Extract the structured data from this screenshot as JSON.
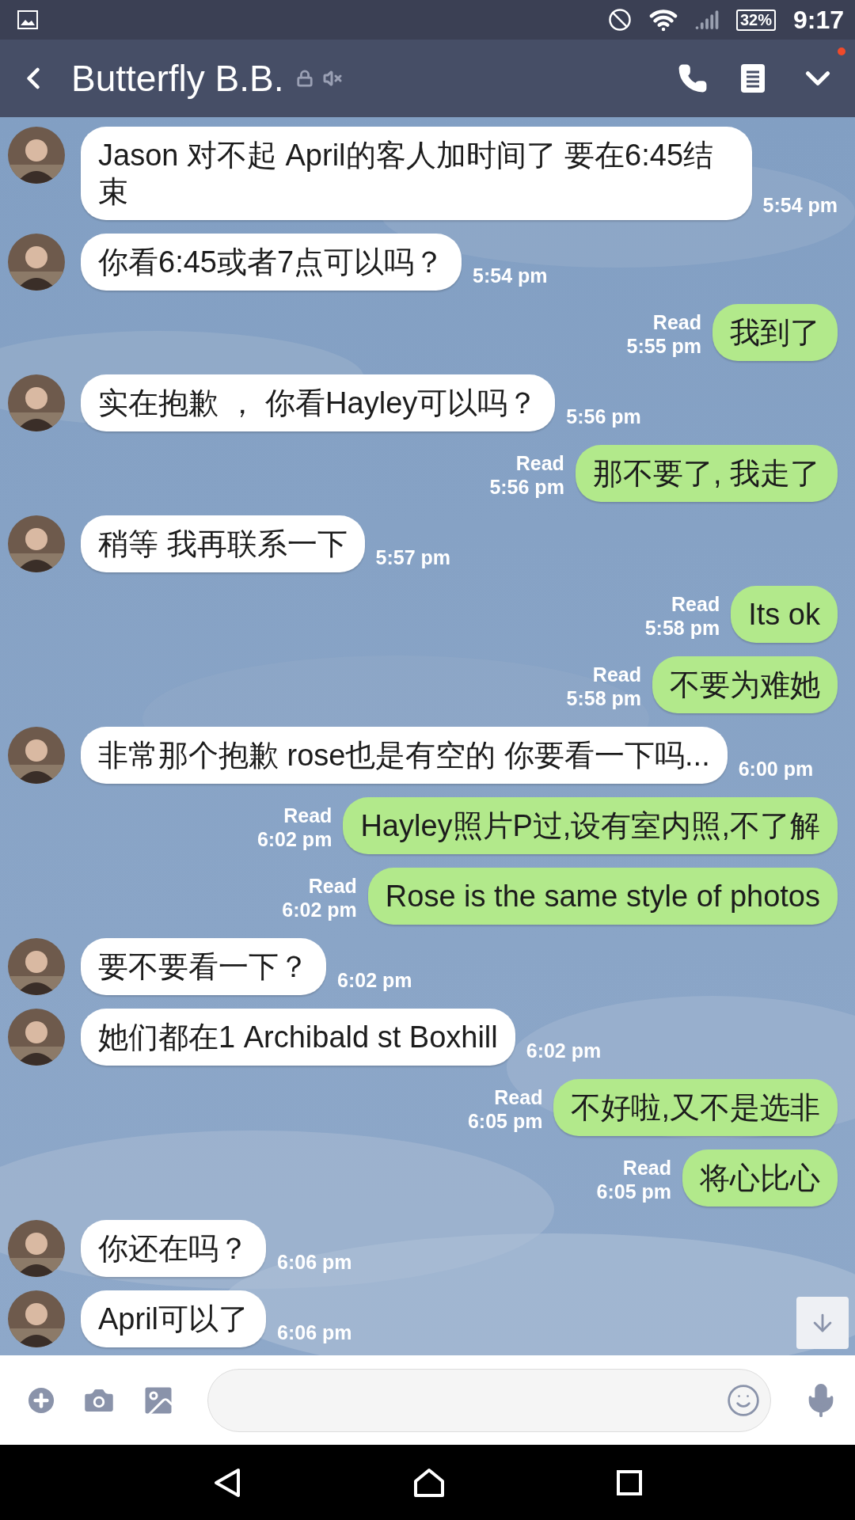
{
  "status_bar": {
    "battery": "32%",
    "time": "9:17"
  },
  "header": {
    "title": "Butterfly B.B.",
    "locked": true,
    "muted": true,
    "menu_badge": true
  },
  "messages": [
    {
      "kind": "in",
      "text": "Jason 对不起 April的客人加时间了 要在6:45结束",
      "time": "5:54 pm"
    },
    {
      "kind": "in",
      "text": "你看6:45或者7点可以吗？",
      "time": "5:54 pm"
    },
    {
      "kind": "out",
      "text": "我到了",
      "read": "Read",
      "time": "5:55 pm"
    },
    {
      "kind": "in",
      "text": "实在抱歉 ， 你看Hayley可以吗？",
      "time": "5:56 pm"
    },
    {
      "kind": "out",
      "text": "那不要了, 我走了",
      "read": "Read",
      "time": "5:56 pm"
    },
    {
      "kind": "in",
      "text": "稍等 我再联系一下",
      "time": "5:57 pm"
    },
    {
      "kind": "out",
      "text": "Its ok",
      "read": "Read",
      "time": "5:58 pm"
    },
    {
      "kind": "out",
      "text": "不要为难她",
      "read": "Read",
      "time": "5:58 pm"
    },
    {
      "kind": "in",
      "text": "非常那个抱歉 rose也是有空的 你要看一下吗...",
      "time": "6:00 pm"
    },
    {
      "kind": "out",
      "text": "Hayley照片P过,设有室内照,不了解",
      "read": "Read",
      "time": "6:02 pm"
    },
    {
      "kind": "out",
      "text": "Rose is the same style of photos",
      "read": "Read",
      "time": "6:02 pm"
    },
    {
      "kind": "in",
      "text": "要不要看一下？",
      "time": "6:02 pm"
    },
    {
      "kind": "in",
      "text": "她们都在1 Archibald st Boxhill",
      "time": "6:02 pm"
    },
    {
      "kind": "out",
      "text": "不好啦,又不是选非",
      "read": "Read",
      "time": "6:05 pm"
    },
    {
      "kind": "out",
      "text": "将心比心",
      "read": "Read",
      "time": "6:05 pm"
    },
    {
      "kind": "in",
      "text": "你还在吗？",
      "time": "6:06 pm"
    },
    {
      "kind": "in",
      "text": "April可以了",
      "time": "6:06 pm"
    }
  ]
}
